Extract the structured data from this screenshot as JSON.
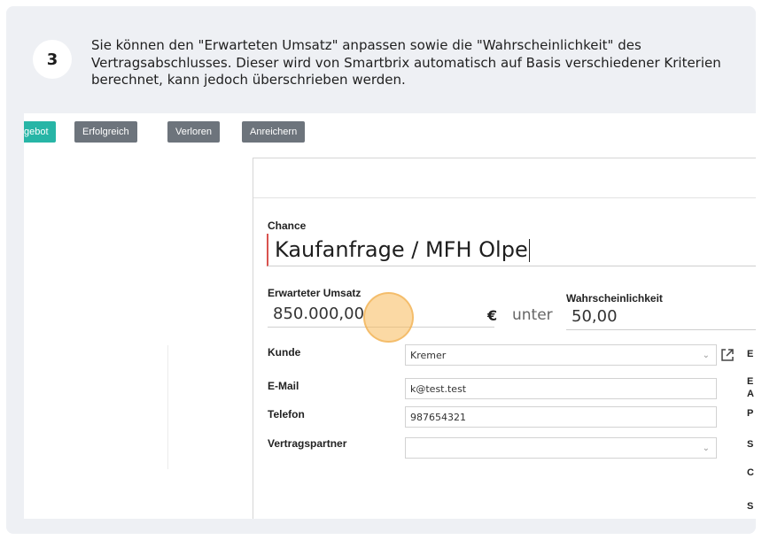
{
  "step": {
    "number": "3",
    "instruction": "Sie können den \"Erwarteten Umsatz\" anpassen sowie die \"Wahrscheinlichkeit\" des Vertragsabschlusses. Dieser wird von Smartbrix automatisch auf Basis verschiedener Kriterien berechnet, kann jedoch überschrieben werden."
  },
  "toolbar": {
    "buttons": [
      {
        "label": "gebot",
        "color": "#27b5a6"
      },
      {
        "label": "Erfolgreich",
        "color": "#6d747c"
      },
      {
        "label": "Verloren",
        "color": "#6d747c"
      },
      {
        "label": "Anreichern",
        "color": "#6d747c"
      }
    ]
  },
  "form": {
    "chance_label": "Chance",
    "chance_value": "Kaufanfrage / MFH Olpe",
    "revenue_label": "Erwarteter Umsatz",
    "revenue_value": "850.000,00",
    "currency": "€",
    "between_text": "unter",
    "probability_label": "Wahrscheinlichkeit",
    "probability_value": "50,00",
    "fields": [
      {
        "label": "Kunde",
        "value": "Kremer",
        "type": "select"
      },
      {
        "label": "E-Mail",
        "value": "k@test.test",
        "type": "text"
      },
      {
        "label": "Telefon",
        "value": "987654321",
        "type": "text"
      },
      {
        "label": "Vertragspartner",
        "value": "",
        "type": "select"
      }
    ],
    "right_column_letters": [
      "E",
      "E",
      "A",
      "P",
      "S",
      "C",
      "S"
    ]
  }
}
